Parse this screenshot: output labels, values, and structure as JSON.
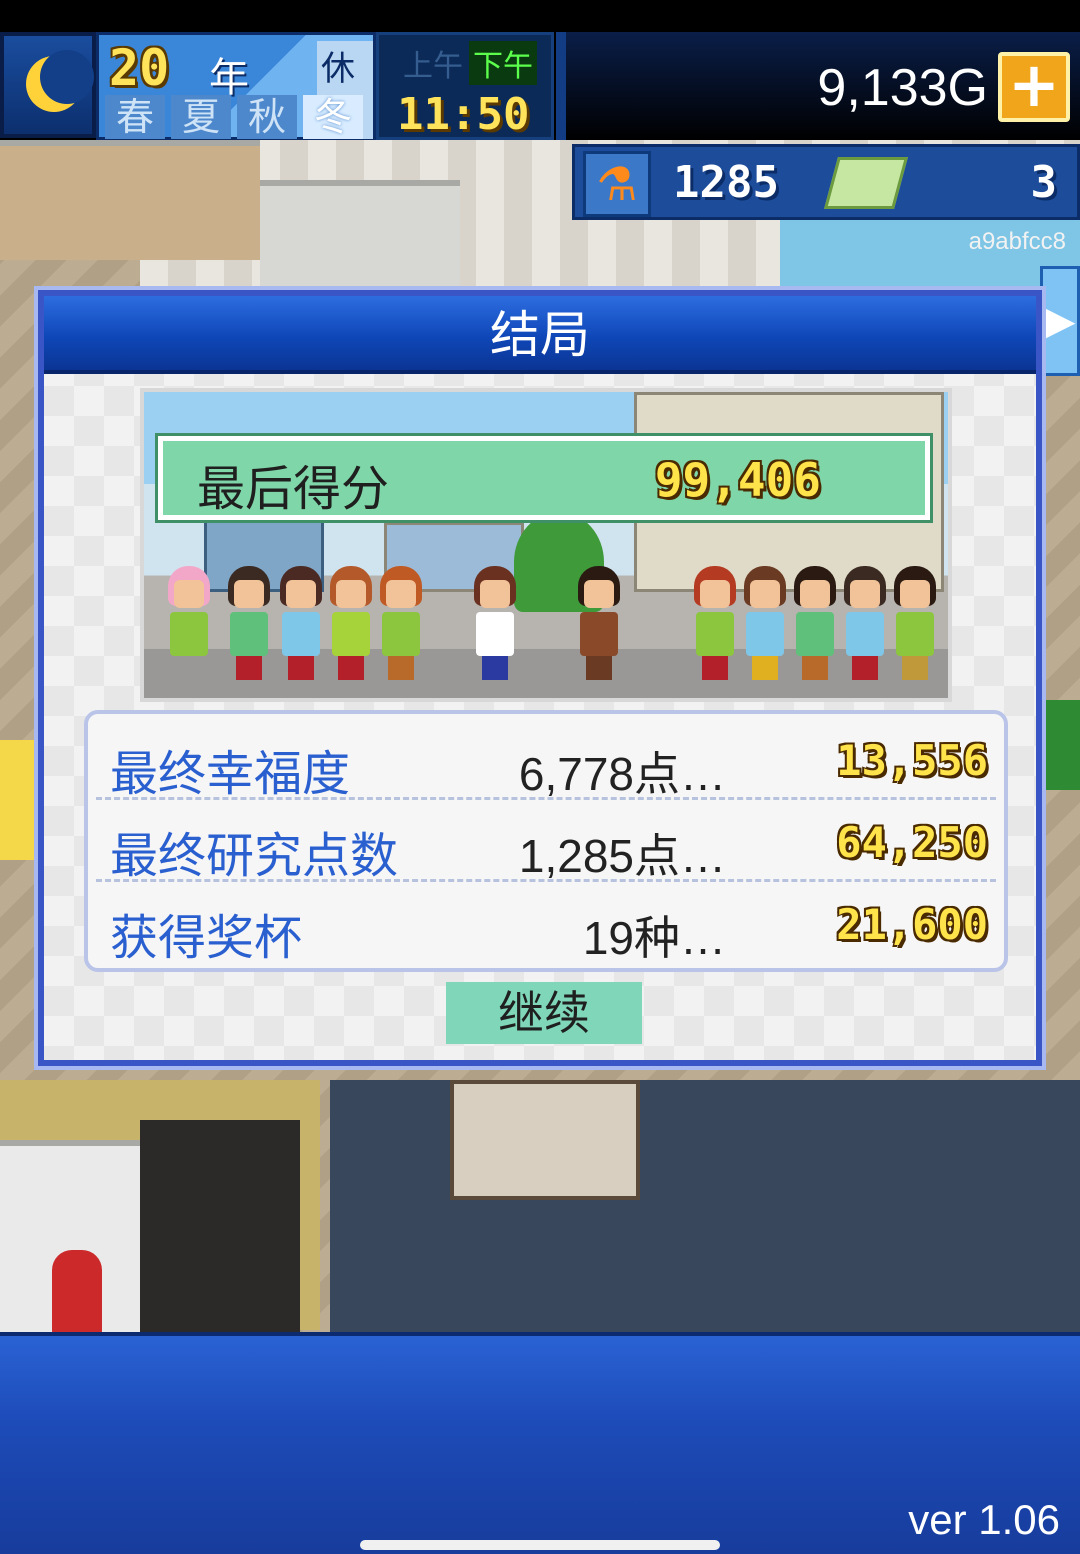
{
  "hud": {
    "year": "20",
    "year_unit": "年",
    "holiday": "休日",
    "seasons": [
      "春",
      "夏",
      "秋",
      "冬"
    ],
    "active_season": "冬",
    "am_label": "上午",
    "pm_label": "下午",
    "time": "11:50",
    "money": "9,133G",
    "plus_label": "+",
    "research_points": "1285",
    "tickets": "3",
    "user_id": "a9abfcc8",
    "side_arrow": "▶"
  },
  "dialog": {
    "title": "结局",
    "final_score_label": "最后得分",
    "final_score_value": "99,406",
    "rows": [
      {
        "label": "最终幸福度",
        "detail": "6,778点…",
        "value": "13,556"
      },
      {
        "label": "最终研究点数",
        "detail": "1,285点…",
        "value": "64,250"
      },
      {
        "label": "获得奖杯",
        "detail": "19种…",
        "value": "21,600"
      }
    ],
    "continue_label": "继续"
  },
  "footer": {
    "version": "ver 1.06"
  },
  "colors": {
    "title_bar": "#0f47b8",
    "score_banner": "#7fd6a8",
    "continue_button": "#7fd6b8",
    "value_gold": "#ffe34a",
    "row_label_blue": "#2a5fd0"
  }
}
